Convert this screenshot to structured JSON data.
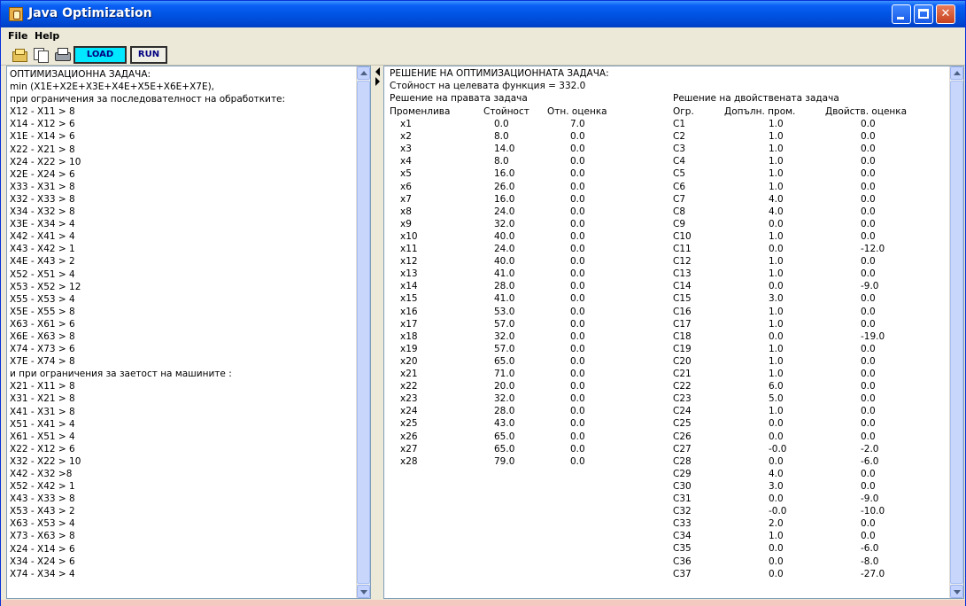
{
  "window": {
    "title": "Java Optimization"
  },
  "menu": {
    "file": "File",
    "help": "Help"
  },
  "toolbar": {
    "load": "LOAD",
    "run": "RUN",
    "icons": [
      "open-folder-icon",
      "copy-icon",
      "print-icon"
    ]
  },
  "left_pane": {
    "lines": [
      "ОПТИМИЗАЦИОННА ЗАДАЧА:",
      "min (X1E+X2E+X3E+X4E+X5E+X6E+X7E),",
      "при ограничения за последователност на обработките:",
      "X12 - X11  > 8",
      "X14 - X12 > 6",
      "X1E - X14 > 6",
      "X22 - X21 > 8",
      "X24 - X22 > 10",
      "X2E - X24 > 6",
      "X33 - X31 > 8",
      "X32 - X33 > 8",
      "X34 - X32 > 8",
      "X3E - X34 > 4",
      "X42 - X41 > 4",
      "X43 - X42 > 1",
      "X4E - X43 > 2",
      "X52 - X51 > 4",
      "X53 - X52 > 12",
      "X55 - X53 > 4",
      "X5E - X55 > 8",
      "X63 - X61 > 6",
      "X6E - X63 > 8",
      "X74 - X73 > 6",
      "X7E - X74 > 8",
      "и при ограничения за заетост на машините :",
      "X21 - X11 > 8",
      "X31 - X21 > 8",
      "X41 - X31 > 8",
      "X51 - X41 > 4",
      "X61 - X51 > 4",
      "X22 - X12 > 6",
      "X32 - X22 > 10",
      "X42 - X32 >8",
      "X52 - X42 > 1",
      "X43 - X33 > 8",
      "X53 - X43 > 2",
      "X63 - X53 > 4",
      "X73 - X63 > 8",
      "X24 - X14 > 6",
      "X34 - X24 > 6",
      "X74 - X34 > 4"
    ]
  },
  "right_pane": {
    "title": "РЕШЕНИЕ НА ОПТИМИЗАЦИОННАТА ЗАДАЧА:",
    "objective": "Стойност на целевата функция = 332.0",
    "primal_title": "Решение на правата задача",
    "dual_title": "Решение на двойствената задача",
    "headers": {
      "variable": "Променлива",
      "value": "Стойност",
      "reduced_cost": "Отн. оценка",
      "constraint": "Огр.",
      "slack": "Допълн. пром.",
      "dual": "Двойств. оценка"
    },
    "primal": [
      [
        "x1",
        "0.0",
        "7.0"
      ],
      [
        "x2",
        "8.0",
        "0.0"
      ],
      [
        "x3",
        "14.0",
        "0.0"
      ],
      [
        "x4",
        "8.0",
        "0.0"
      ],
      [
        "x5",
        "16.0",
        "0.0"
      ],
      [
        "x6",
        "26.0",
        "0.0"
      ],
      [
        "x7",
        "16.0",
        "0.0"
      ],
      [
        "x8",
        "24.0",
        "0.0"
      ],
      [
        "x9",
        "32.0",
        "0.0"
      ],
      [
        "x10",
        "40.0",
        "0.0"
      ],
      [
        "x11",
        "24.0",
        "0.0"
      ],
      [
        "x12",
        "40.0",
        "0.0"
      ],
      [
        "x13",
        "41.0",
        "0.0"
      ],
      [
        "x14",
        "28.0",
        "0.0"
      ],
      [
        "x15",
        "41.0",
        "0.0"
      ],
      [
        "x16",
        "53.0",
        "0.0"
      ],
      [
        "x17",
        "57.0",
        "0.0"
      ],
      [
        "x18",
        "32.0",
        "0.0"
      ],
      [
        "x19",
        "57.0",
        "0.0"
      ],
      [
        "x20",
        "65.0",
        "0.0"
      ],
      [
        "x21",
        "71.0",
        "0.0"
      ],
      [
        "x22",
        "20.0",
        "0.0"
      ],
      [
        "x23",
        "32.0",
        "0.0"
      ],
      [
        "x24",
        "28.0",
        "0.0"
      ],
      [
        "x25",
        "43.0",
        "0.0"
      ],
      [
        "x26",
        "65.0",
        "0.0"
      ],
      [
        "x27",
        "65.0",
        "0.0"
      ],
      [
        "x28",
        "79.0",
        "0.0"
      ]
    ],
    "dual": [
      [
        "C1",
        "1.0",
        "0.0"
      ],
      [
        "C2",
        "1.0",
        "0.0"
      ],
      [
        "C3",
        "1.0",
        "0.0"
      ],
      [
        "C4",
        "1.0",
        "0.0"
      ],
      [
        "C5",
        "1.0",
        "0.0"
      ],
      [
        "C6",
        "1.0",
        "0.0"
      ],
      [
        "C7",
        "4.0",
        "0.0"
      ],
      [
        "C8",
        "4.0",
        "0.0"
      ],
      [
        "C9",
        "0.0",
        "0.0"
      ],
      [
        "C10",
        "1.0",
        "0.0"
      ],
      [
        "C11",
        "0.0",
        "-12.0"
      ],
      [
        "C12",
        "1.0",
        "0.0"
      ],
      [
        "C13",
        "1.0",
        "0.0"
      ],
      [
        "C14",
        "0.0",
        "-9.0"
      ],
      [
        "C15",
        "3.0",
        "0.0"
      ],
      [
        "C16",
        "1.0",
        "0.0"
      ],
      [
        "C17",
        "1.0",
        "0.0"
      ],
      [
        "C18",
        "0.0",
        "-19.0"
      ],
      [
        "C19",
        "1.0",
        "0.0"
      ],
      [
        "C20",
        "1.0",
        "0.0"
      ],
      [
        "C21",
        "1.0",
        "0.0"
      ],
      [
        "C22",
        "6.0",
        "0.0"
      ],
      [
        "C23",
        "5.0",
        "0.0"
      ],
      [
        "C24",
        "1.0",
        "0.0"
      ],
      [
        "C25",
        "0.0",
        "0.0"
      ],
      [
        "C26",
        "0.0",
        "0.0"
      ],
      [
        "C27",
        "-0.0",
        "-2.0"
      ],
      [
        "C28",
        "0.0",
        "-6.0"
      ],
      [
        "C29",
        "4.0",
        "0.0"
      ],
      [
        "C30",
        "3.0",
        "0.0"
      ],
      [
        "C31",
        "0.0",
        "-9.0"
      ],
      [
        "C32",
        "-0.0",
        "-10.0"
      ],
      [
        "C33",
        "2.0",
        "0.0"
      ],
      [
        "C34",
        "1.0",
        "0.0"
      ],
      [
        "C35",
        "0.0",
        "-6.0"
      ],
      [
        "C36",
        "0.0",
        "-8.0"
      ],
      [
        "C37",
        "0.0",
        "-27.0"
      ]
    ]
  }
}
